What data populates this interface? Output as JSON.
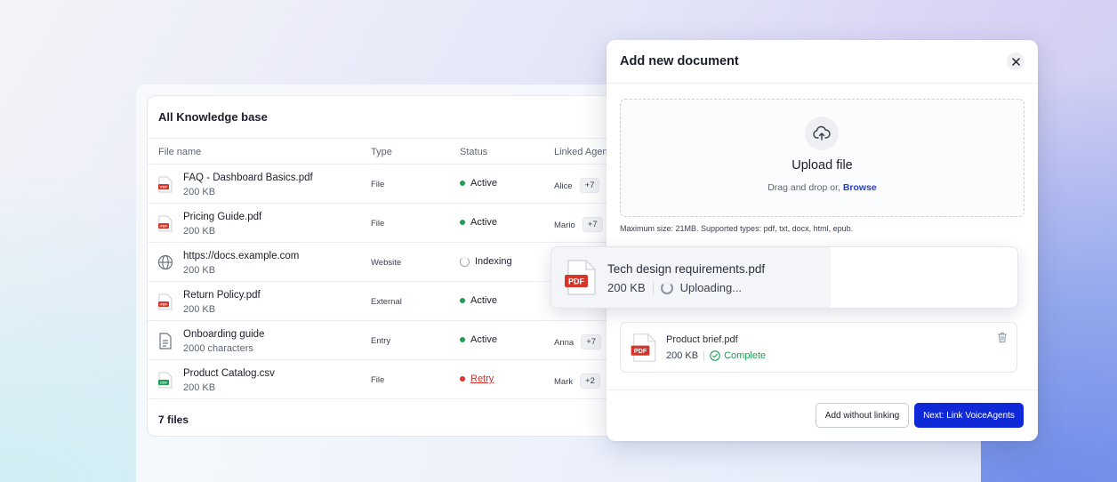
{
  "knowledge_base": {
    "title": "All Knowledge base",
    "columns": {
      "name": "File name",
      "type": "Type",
      "status": "Status",
      "agents": "Linked Agen"
    },
    "rows": [
      {
        "name": "FAQ - Dashboard Basics.pdf",
        "size": "200 KB",
        "type": "File",
        "status": "Active",
        "icon": "pdf-file-icon",
        "agent": "Alice",
        "agent_more": "+7"
      },
      {
        "name": "Pricing Guide.pdf",
        "size": "200 KB",
        "type": "File",
        "status": "Active",
        "icon": "pdf-file-icon",
        "agent": "Mario",
        "agent_more": "+7"
      },
      {
        "name": "https://docs.example.com",
        "size": "200 KB",
        "type": "Website",
        "status": "Indexing",
        "icon": "globe-icon",
        "agent": "",
        "agent_more": ""
      },
      {
        "name": "Return Policy.pdf",
        "size": "200 KB",
        "type": "External",
        "status": "Active",
        "icon": "pdf-file-icon",
        "agent": "",
        "agent_more": ""
      },
      {
        "name": "Onboarding guide",
        "size": "2000 characters",
        "type": "Entry",
        "status": "Active",
        "icon": "document-icon",
        "agent": "Anna",
        "agent_more": "+7"
      },
      {
        "name": "Product Catalog.csv",
        "size": "200 KB",
        "type": "File",
        "status": "Retry",
        "icon": "csv-file-icon",
        "agent": "Mark",
        "agent_more": "+2"
      }
    ],
    "footer": "7 files"
  },
  "modal": {
    "title": "Add new document",
    "upload": {
      "title": "Upload file",
      "subtitle": "Drag and drop or,",
      "browse": "Browse",
      "max_note": "Maximum size: 21MB. Supported types: pdf, txt, docx, html, epub."
    },
    "uploading_file": {
      "name": "Tech design requirements.pdf",
      "size": "200 KB",
      "status": "Uploading...",
      "progress": 0.6,
      "badge": "PDF"
    },
    "uploaded_file": {
      "name": "Product brief.pdf",
      "size": "200 KB",
      "status": "Complete",
      "badge": "PDF"
    },
    "buttons": {
      "secondary": "Add without linking",
      "primary": "Next: Link VoiceAgents"
    }
  },
  "colors": {
    "primary": "#1029d8",
    "success": "#1f9d55",
    "danger": "#d3322c",
    "pdf_red": "#d8342b",
    "csv_green": "#1f9d55",
    "browse_link": "#1e3ed2"
  },
  "icon_labels": {
    "pdf": "PDF",
    "csv": "CSV"
  }
}
